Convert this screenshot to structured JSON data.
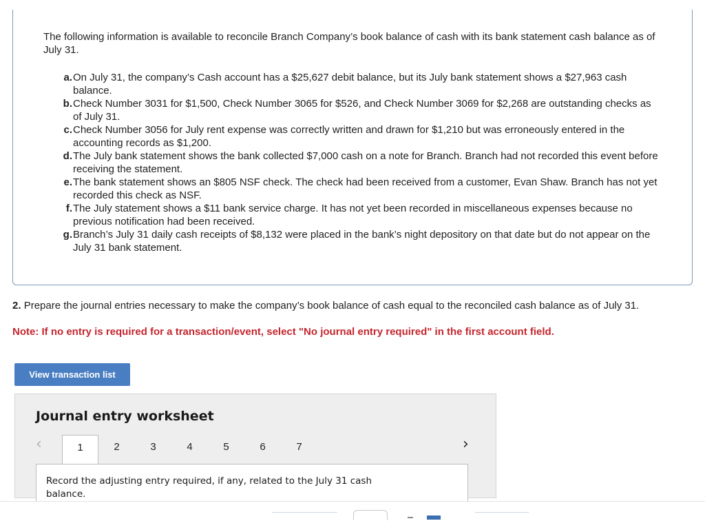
{
  "intro": "The following information is available to reconcile Branch Company’s book balance of cash with its bank statement cash balance as of July 31.",
  "items": [
    {
      "letter": "a.",
      "text": "On July 31, the company’s Cash account has a $25,627 debit balance, but its July bank statement shows a $27,963 cash balance."
    },
    {
      "letter": "b.",
      "text": "Check Number 3031 for $1,500, Check Number 3065 for $526, and Check Number 3069 for $2,268 are outstanding checks as of July 31."
    },
    {
      "letter": "c.",
      "text": "Check Number 3056 for July rent expense was correctly written and drawn for $1,210 but was erroneously entered in the accounting records as $1,200."
    },
    {
      "letter": "d.",
      "text": "The July bank statement shows the bank collected $7,000 cash on a note for Branch. Branch had not recorded this event before receiving the statement."
    },
    {
      "letter": "e.",
      "text": "The bank statement shows an $805 NSF check. The check had been received from a customer, Evan Shaw. Branch has not yet recorded this check as NSF."
    },
    {
      "letter": "f.",
      "text": "The July statement shows a $11 bank service charge. It has not yet been recorded in miscellaneous expenses because no previous notification had been received."
    },
    {
      "letter": "g.",
      "text": "Branch’s July 31 daily cash receipts of $8,132 were placed in the bank’s night depository on that date but do not appear on the July 31 bank statement."
    }
  ],
  "question": {
    "number": "2.",
    "text": "Prepare the journal entries necessary to make the company’s book balance of cash equal to the reconciled cash balance as of July 31."
  },
  "note": "Note: If no entry is required for a transaction/event, select \"No journal entry required\" in the first account field.",
  "view_button_label": "View transaction list",
  "worksheet": {
    "title": "Journal entry worksheet",
    "prev_icon": "‹",
    "next_icon": "›",
    "tabs": [
      "1",
      "2",
      "3",
      "4",
      "5",
      "6",
      "7"
    ],
    "active_tab": "1",
    "instruction": "Record the adjusting entry required, if any, related to the July 31 cash balance."
  },
  "colors": {
    "note_red": "#c4262e",
    "button_blue": "#4a7ec2",
    "box_border": "#7d9ab8"
  }
}
